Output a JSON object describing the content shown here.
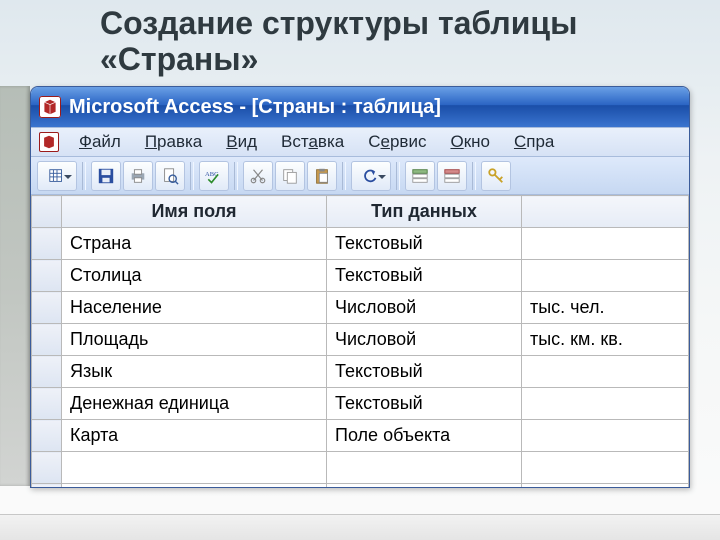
{
  "slide": {
    "title": "Создание структуры таблицы «Страны»"
  },
  "titlebar": {
    "text": "Microsoft Access - [Страны : таблица]"
  },
  "menu": {
    "file": "Файл",
    "edit": "Правка",
    "view": "Вид",
    "insert": "Вст_авка",
    "insert_plain": "Вставка",
    "service": "Сервис",
    "window": "Окно",
    "help": "Справ"
  },
  "grid": {
    "headers": {
      "name": "Имя поля",
      "type": "Тип данных",
      "desc": ""
    },
    "rows": [
      {
        "name": "Страна",
        "type": "Текстовый",
        "desc": ""
      },
      {
        "name": "Столица",
        "type": "Текстовый",
        "desc": ""
      },
      {
        "name": "Население",
        "type": "Числовой",
        "desc": "тыс. чел."
      },
      {
        "name": "Площадь",
        "type": "Числовой",
        "desc": "тыс. км. кв."
      },
      {
        "name": "Язык",
        "type": "Текстовый",
        "desc": ""
      },
      {
        "name": "Денежная единица",
        "type": "Текстовый",
        "desc": ""
      },
      {
        "name": "Карта",
        "type": "Поле объекта",
        "desc": ""
      },
      {
        "name": "",
        "type": "",
        "desc": ""
      },
      {
        "name": "",
        "type": "",
        "desc": ""
      }
    ]
  }
}
